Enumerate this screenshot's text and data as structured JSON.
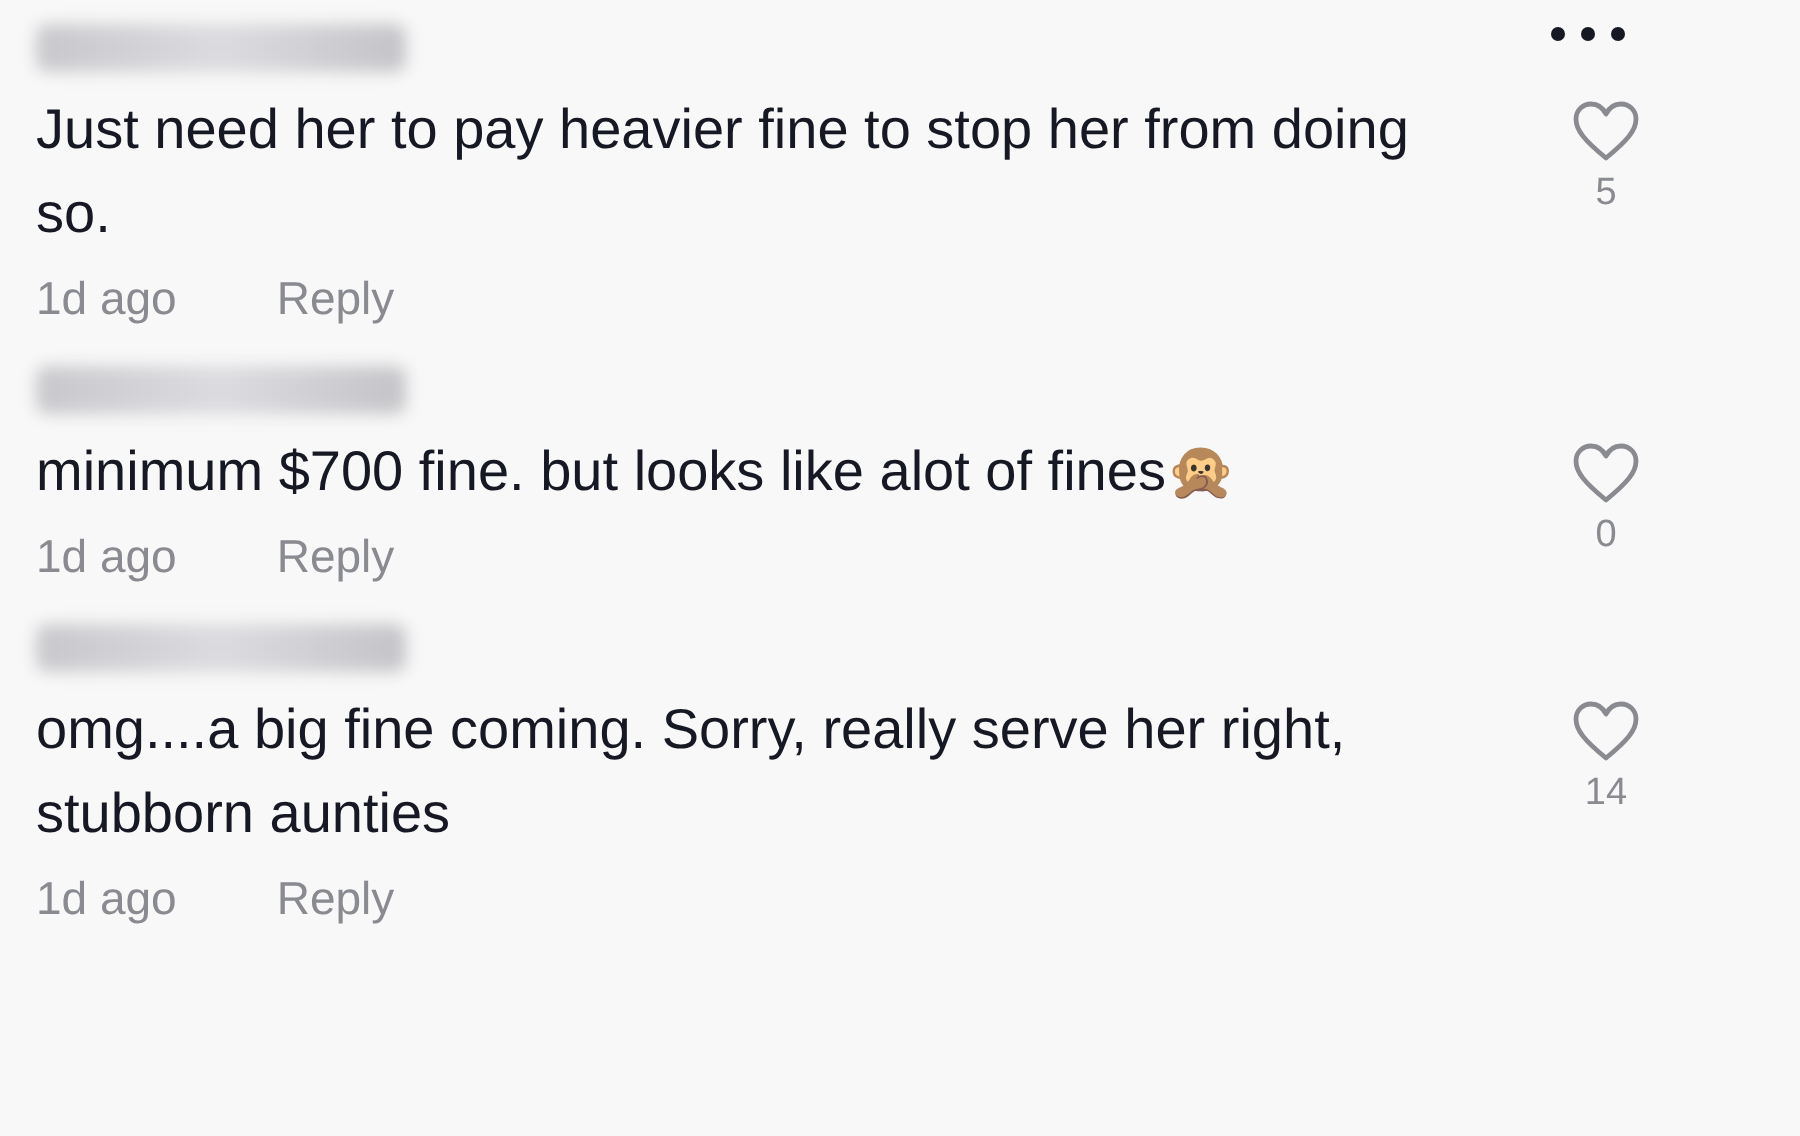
{
  "comments": [
    {
      "text": "Just need her to pay heavier fine to stop her from doing so.",
      "time": "1d ago",
      "reply": "Reply",
      "likes": "5",
      "liked": false,
      "more": true
    },
    {
      "text": "minimum $700 fine. but looks like alot of fines🙊",
      "time": "1d ago",
      "reply": "Reply",
      "likes": "0",
      "liked": false,
      "more": false
    },
    {
      "text": "omg....a big fine coming. Sorry, really serve her right, stubborn aunties",
      "time": "1d ago",
      "reply": "Reply",
      "likes": "14",
      "liked": false,
      "more": false
    }
  ]
}
